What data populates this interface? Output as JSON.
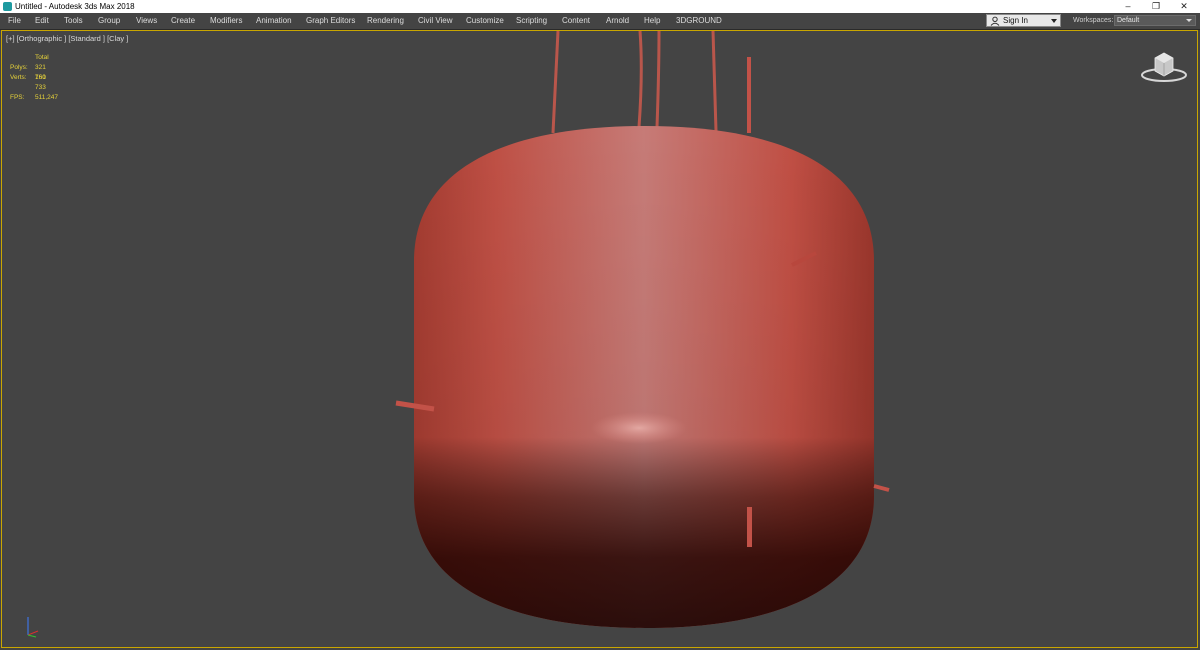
{
  "window": {
    "title": "Untitled - Autodesk 3ds Max 2018",
    "controls": [
      "–",
      "❐",
      "✕"
    ]
  },
  "menu": {
    "items": [
      "File",
      "Edit",
      "Tools",
      "Group",
      "Views",
      "Create",
      "Modifiers",
      "Animation",
      "Graph Editors",
      "Rendering",
      "Civil View",
      "Customize",
      "Scripting",
      "Content",
      "Arnold",
      "Help",
      "3DGROUND"
    ]
  },
  "account": {
    "sign_in_label": "Sign In"
  },
  "workspaces": {
    "label": "Workspaces:",
    "value": "Default"
  },
  "viewport": {
    "label": "[+] [Orthographic ] [Standard ] [Clay ]",
    "stats": {
      "header": "Total",
      "polys_label": "Polys:",
      "polys_value": "321 760",
      "verts_label": "Verts:",
      "verts_value": "161 733",
      "fps_label": "FPS:",
      "fps_value": "511,247"
    },
    "colors": {
      "border": "#c9a600",
      "clay": "#c0564a",
      "background": "#444444"
    },
    "icons": [
      "viewcube-icon",
      "axis-tripod-icon"
    ]
  }
}
